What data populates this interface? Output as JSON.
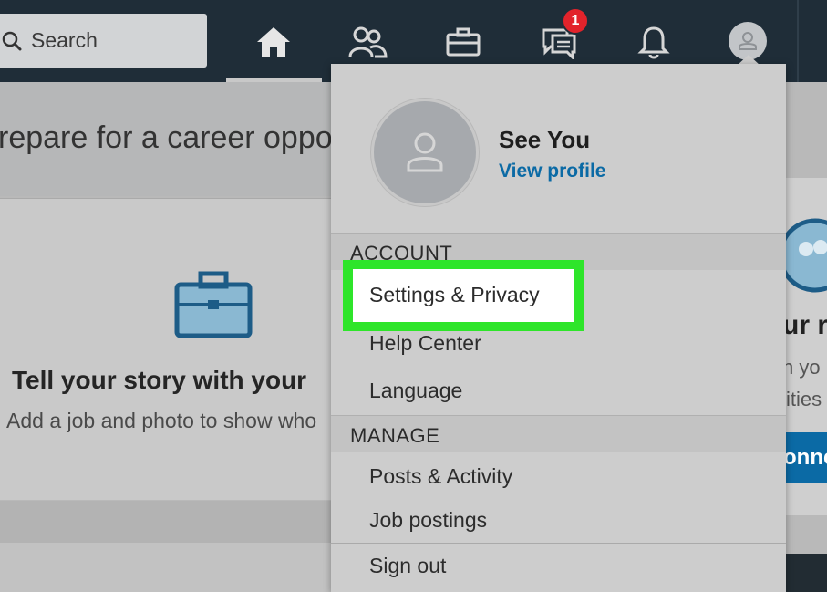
{
  "nav": {
    "search_placeholder": "Search",
    "messages_badge": "1",
    "colors": {
      "bar": "#1f2d38",
      "badge": "#e2232b"
    }
  },
  "background": {
    "banner_text": "repare for a career oppo",
    "card_title": "Tell your story with your",
    "card_subtitle": "Add a job and photo to show who",
    "right_title": "ur r",
    "right_line1": "n yo",
    "right_line2": "ities",
    "right_button": "onne"
  },
  "dropdown": {
    "name": "See You",
    "view_profile": "View profile",
    "account_header": "ACCOUNT",
    "account_items": [
      "Settings & Privacy",
      "Help Center",
      "Language"
    ],
    "manage_header": "MANAGE",
    "manage_items": [
      "Posts & Activity",
      "Job postings"
    ],
    "sign_out": "Sign out",
    "highlight_color": "#2ee52a",
    "link_color": "#0b6aa5"
  }
}
